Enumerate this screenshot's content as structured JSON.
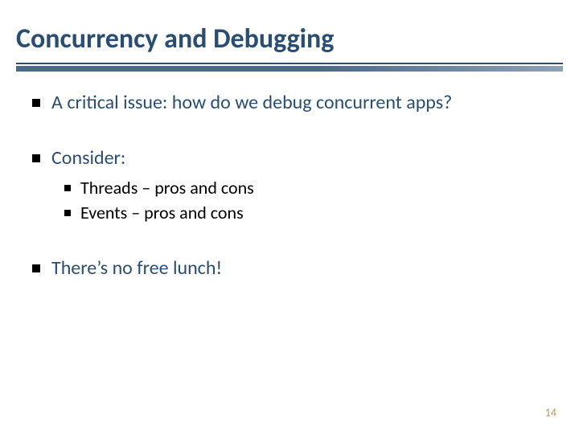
{
  "slide": {
    "title": "Concurrency and Debugging",
    "bullets": [
      {
        "text": "A critical issue:  how do we debug concurrent apps?",
        "sub": []
      },
      {
        "text": "Consider:",
        "sub": [
          "Threads – pros and cons",
          "Events – pros and cons"
        ]
      },
      {
        "text": "There’s no free lunch!",
        "sub": []
      }
    ],
    "page_number": "14"
  }
}
